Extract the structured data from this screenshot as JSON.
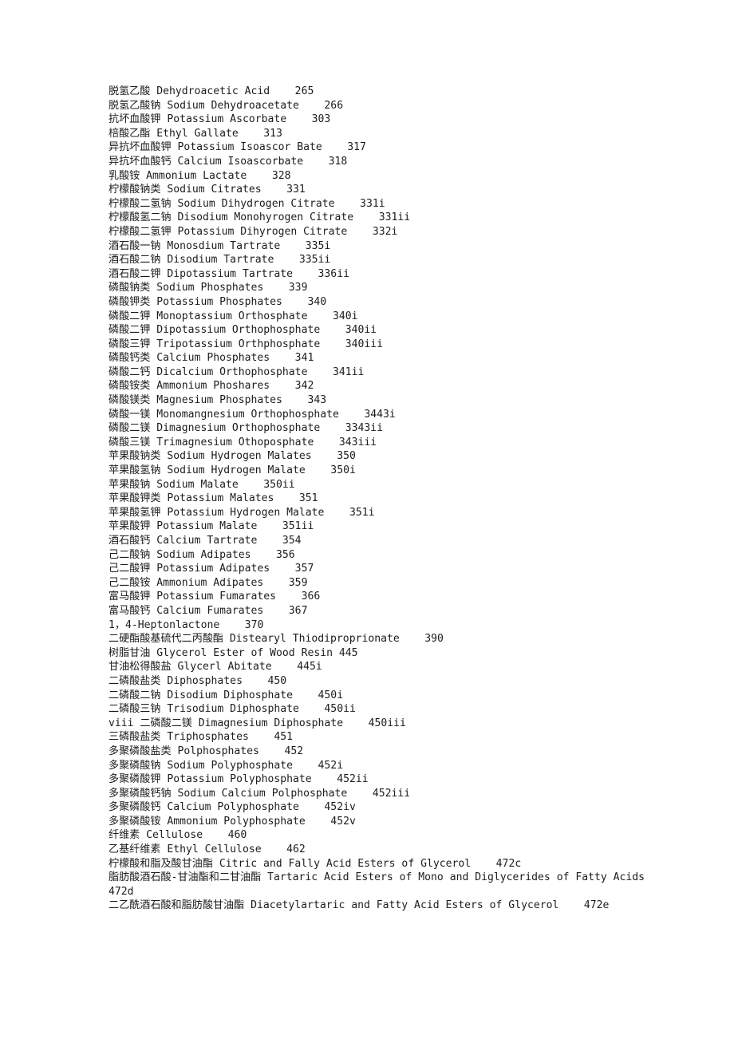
{
  "document": {
    "background_color": "#ffffff",
    "text_color": "#1c1c1c",
    "entries": [
      {
        "line": "脱氢乙酸 Dehydroacetic Acid    265"
      },
      {
        "line": "脱氢乙酸钠 Sodium Dehydroacetate    266"
      },
      {
        "line": "抗坏血酸钾 Potassium Ascorbate    303"
      },
      {
        "line": "棓酸乙酯 Ethyl Gallate    313"
      },
      {
        "line": "异抗坏血酸钾 Potassium Isoascor Bate    317"
      },
      {
        "line": "异抗坏血酸钙 Calcium Isoascorbate    318"
      },
      {
        "line": "乳酸铵 Ammonium Lactate    328"
      },
      {
        "line": "柠檬酸钠类 Sodium Citrates    331"
      },
      {
        "line": "柠檬酸二氢钠 Sodium Dihydrogen Citrate    331i"
      },
      {
        "line": "柠檬酸氢二钠 Disodium Monohyrogen Citrate    331ii"
      },
      {
        "line": "柠檬酸二氢钾 Potassium Dihyrogen Citrate    332i"
      },
      {
        "line": "酒石酸一钠 Monosdium Tartrate    335i"
      },
      {
        "line": "酒石酸二钠 Disodium Tartrate    335ii"
      },
      {
        "line": "酒石酸二钾 Dipotassium Tartrate    336ii"
      },
      {
        "line": "磷酸钠类 Sodium Phosphates    339"
      },
      {
        "line": "磷酸钾类 Potassium Phosphates    340"
      },
      {
        "line": "磷酸二钾 Monoptassium Orthosphate    340i"
      },
      {
        "line": "磷酸二钾 Dipotassium Orthophosphate    340ii"
      },
      {
        "line": "磷酸三钾 Tripotassium Orthphosphate    340iii"
      },
      {
        "line": "磷酸钙类 Calcium Phosphates    341"
      },
      {
        "line": "磷酸二钙 Dicalcium Orthophosphate    341ii"
      },
      {
        "line": "磷酸铵类 Ammonium Phoshares    342"
      },
      {
        "line": "磷酸镁类 Magnesium Phosphates    343"
      },
      {
        "line": "磷酸一镁 Monomangnesium Orthophosphate    3443i"
      },
      {
        "line": "磷酸二镁 Dimagnesium Orthophosphate    3343ii"
      },
      {
        "line": "磷酸三镁 Trimagnesium Othoposphate    343iii"
      },
      {
        "line": "苹果酸钠类 Sodium Hydrogen Malates    350"
      },
      {
        "line": "苹果酸氢钠 Sodium Hydrogen Malate    350i"
      },
      {
        "line": "苹果酸钠 Sodium Malate    350ii"
      },
      {
        "line": "苹果酸钾类 Potassium Malates    351"
      },
      {
        "line": "苹果酸氢钾 Potassium Hydrogen Malate    351i"
      },
      {
        "line": "苹果酸钾 Potassium Malate    351ii"
      },
      {
        "line": "酒石酸钙 Calcium Tartrate    354"
      },
      {
        "line": "己二酸钠 Sodium Adipates    356"
      },
      {
        "line": "己二酸钾 Potassium Adipates    357"
      },
      {
        "line": "己二酸铵 Ammonium Adipates    359"
      },
      {
        "line": "富马酸钾 Potassium Fumarates    366"
      },
      {
        "line": "富马酸钙 Calcium Fumarates    367"
      },
      {
        "line": "1，4-Heptonlactone    370"
      },
      {
        "line": "二硬酯酸基硫代二丙酸酯 Distearyl Thiodiproprionate    390"
      },
      {
        "line": "树脂甘油 Glycerol Ester of Wood Resin 445"
      },
      {
        "line": "甘油松得酸盐 Glycerl Abitate    445i"
      },
      {
        "line": "二磷酸盐类 Diphosphates    450"
      },
      {
        "line": "二磷酸二钠 Disodium Diphosphate    450i"
      },
      {
        "line": "二磷酸三钠 Trisodium Diphosphate    450ii"
      },
      {
        "line": "viii 二磷酸二镁 Dimagnesium Diphosphate    450iii"
      },
      {
        "line": "三磷酸盐类 Triphosphates    451"
      },
      {
        "line": "多聚磷酸盐类 Polphosphates    452"
      },
      {
        "line": "多聚磷酸钠 Sodium Polyphosphate    452i"
      },
      {
        "line": "多聚磷酸钾 Potassium Polyphosphate    452ii"
      },
      {
        "line": "多聚磷酸钙钠 Sodium Calcium Polphosphate    452iii"
      },
      {
        "line": "多聚磷酸钙 Calcium Polyphosphate    452iv"
      },
      {
        "line": "多聚磷酸铵 Ammonium Polyphosphate    452v"
      },
      {
        "line": "纤维素 Cellulose    460"
      },
      {
        "line": "乙基纤维素 Ethyl Cellulose    462"
      },
      {
        "line": "柠檬酸和脂及酸甘油酯 Citric and Fally Acid Esters of Glycerol    472c"
      },
      {
        "line": "脂肪酸酒石酸-甘油酯和二甘油酯 Tartaric Acid Esters of Mono and Diglycerides of Fatty Acids    472d"
      },
      {
        "line": "二乙酰酒石酸和脂肪酸甘油酯 Diacetylartaric and Fatty Acid Esters of Glycerol    472e"
      }
    ]
  }
}
